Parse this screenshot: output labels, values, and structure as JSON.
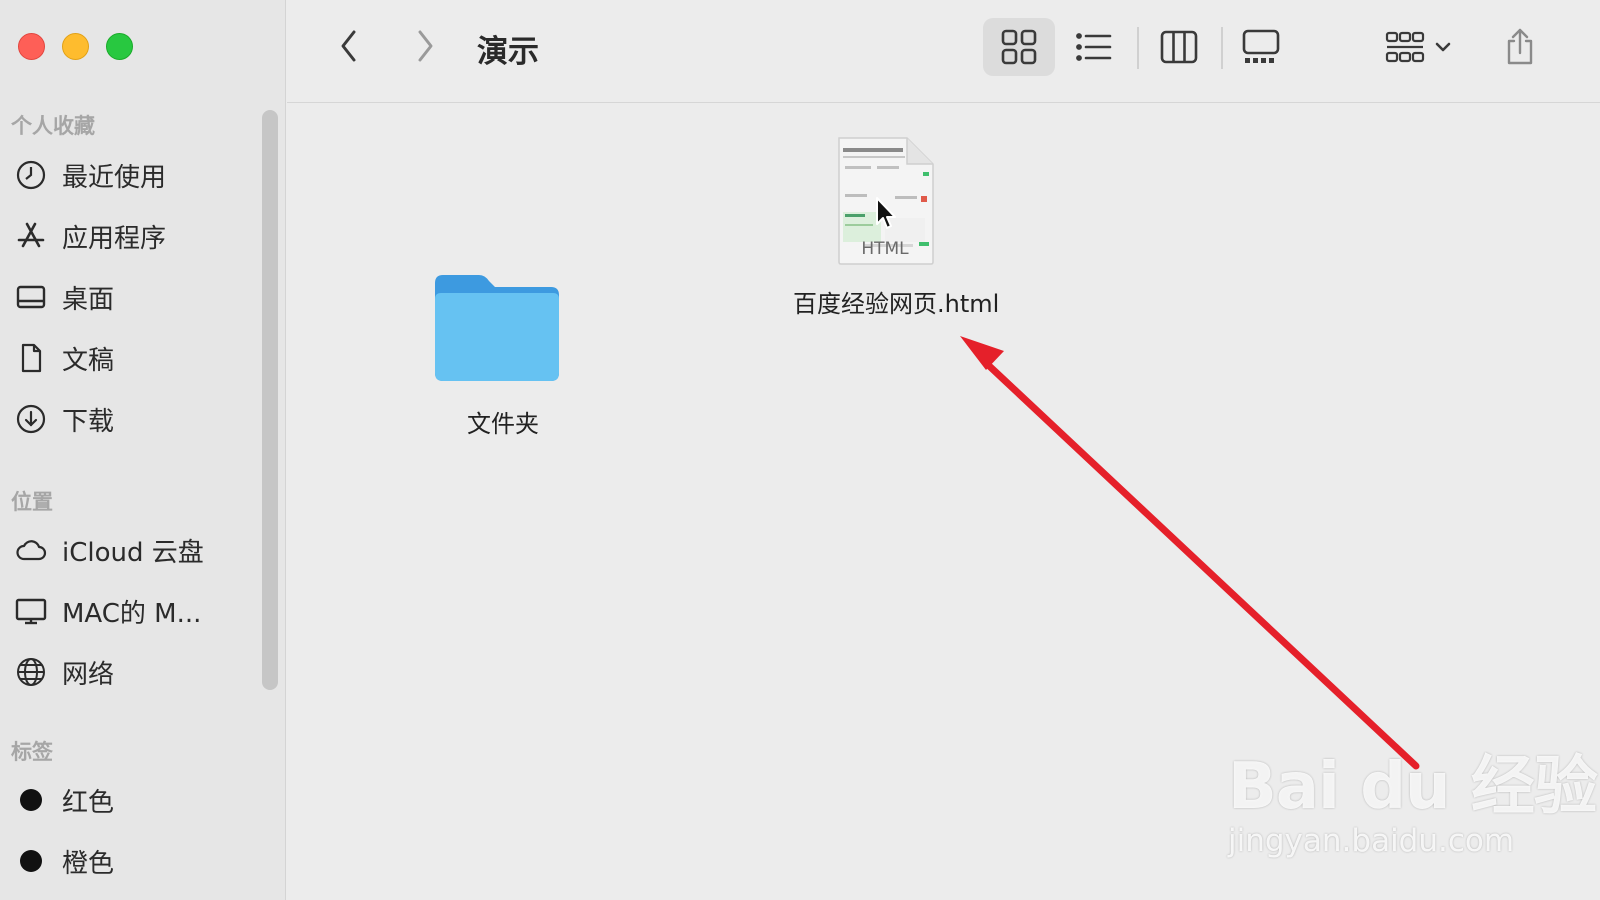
{
  "window": {
    "title": "演示"
  },
  "sidebar": {
    "favorites_title": "个人收藏",
    "favorites": [
      {
        "label": "最近使用",
        "icon": "clock-icon"
      },
      {
        "label": "应用程序",
        "icon": "app-store-icon"
      },
      {
        "label": "桌面",
        "icon": "desktop-icon"
      },
      {
        "label": "文稿",
        "icon": "document-icon"
      },
      {
        "label": "下载",
        "icon": "download-icon"
      }
    ],
    "locations_title": "位置",
    "locations": [
      {
        "label": "iCloud 云盘",
        "icon": "cloud-icon"
      },
      {
        "label": "MAC的 M...",
        "icon": "monitor-icon"
      },
      {
        "label": "网络",
        "icon": "globe-icon"
      }
    ],
    "tags_title": "标签",
    "tags": [
      {
        "label": "红色",
        "color": "#111111"
      },
      {
        "label": "橙色",
        "color": "#111111"
      }
    ]
  },
  "files": [
    {
      "name": "文件夹",
      "type": "folder"
    },
    {
      "name": "百度经验网页.html",
      "type": "html",
      "badge": "HTML"
    }
  ],
  "watermark": {
    "main": "Bai du 经验",
    "sub": "jingyan.baidu.com"
  },
  "colors": {
    "folder": "#63bdf0",
    "arrow": "#e5202a"
  }
}
